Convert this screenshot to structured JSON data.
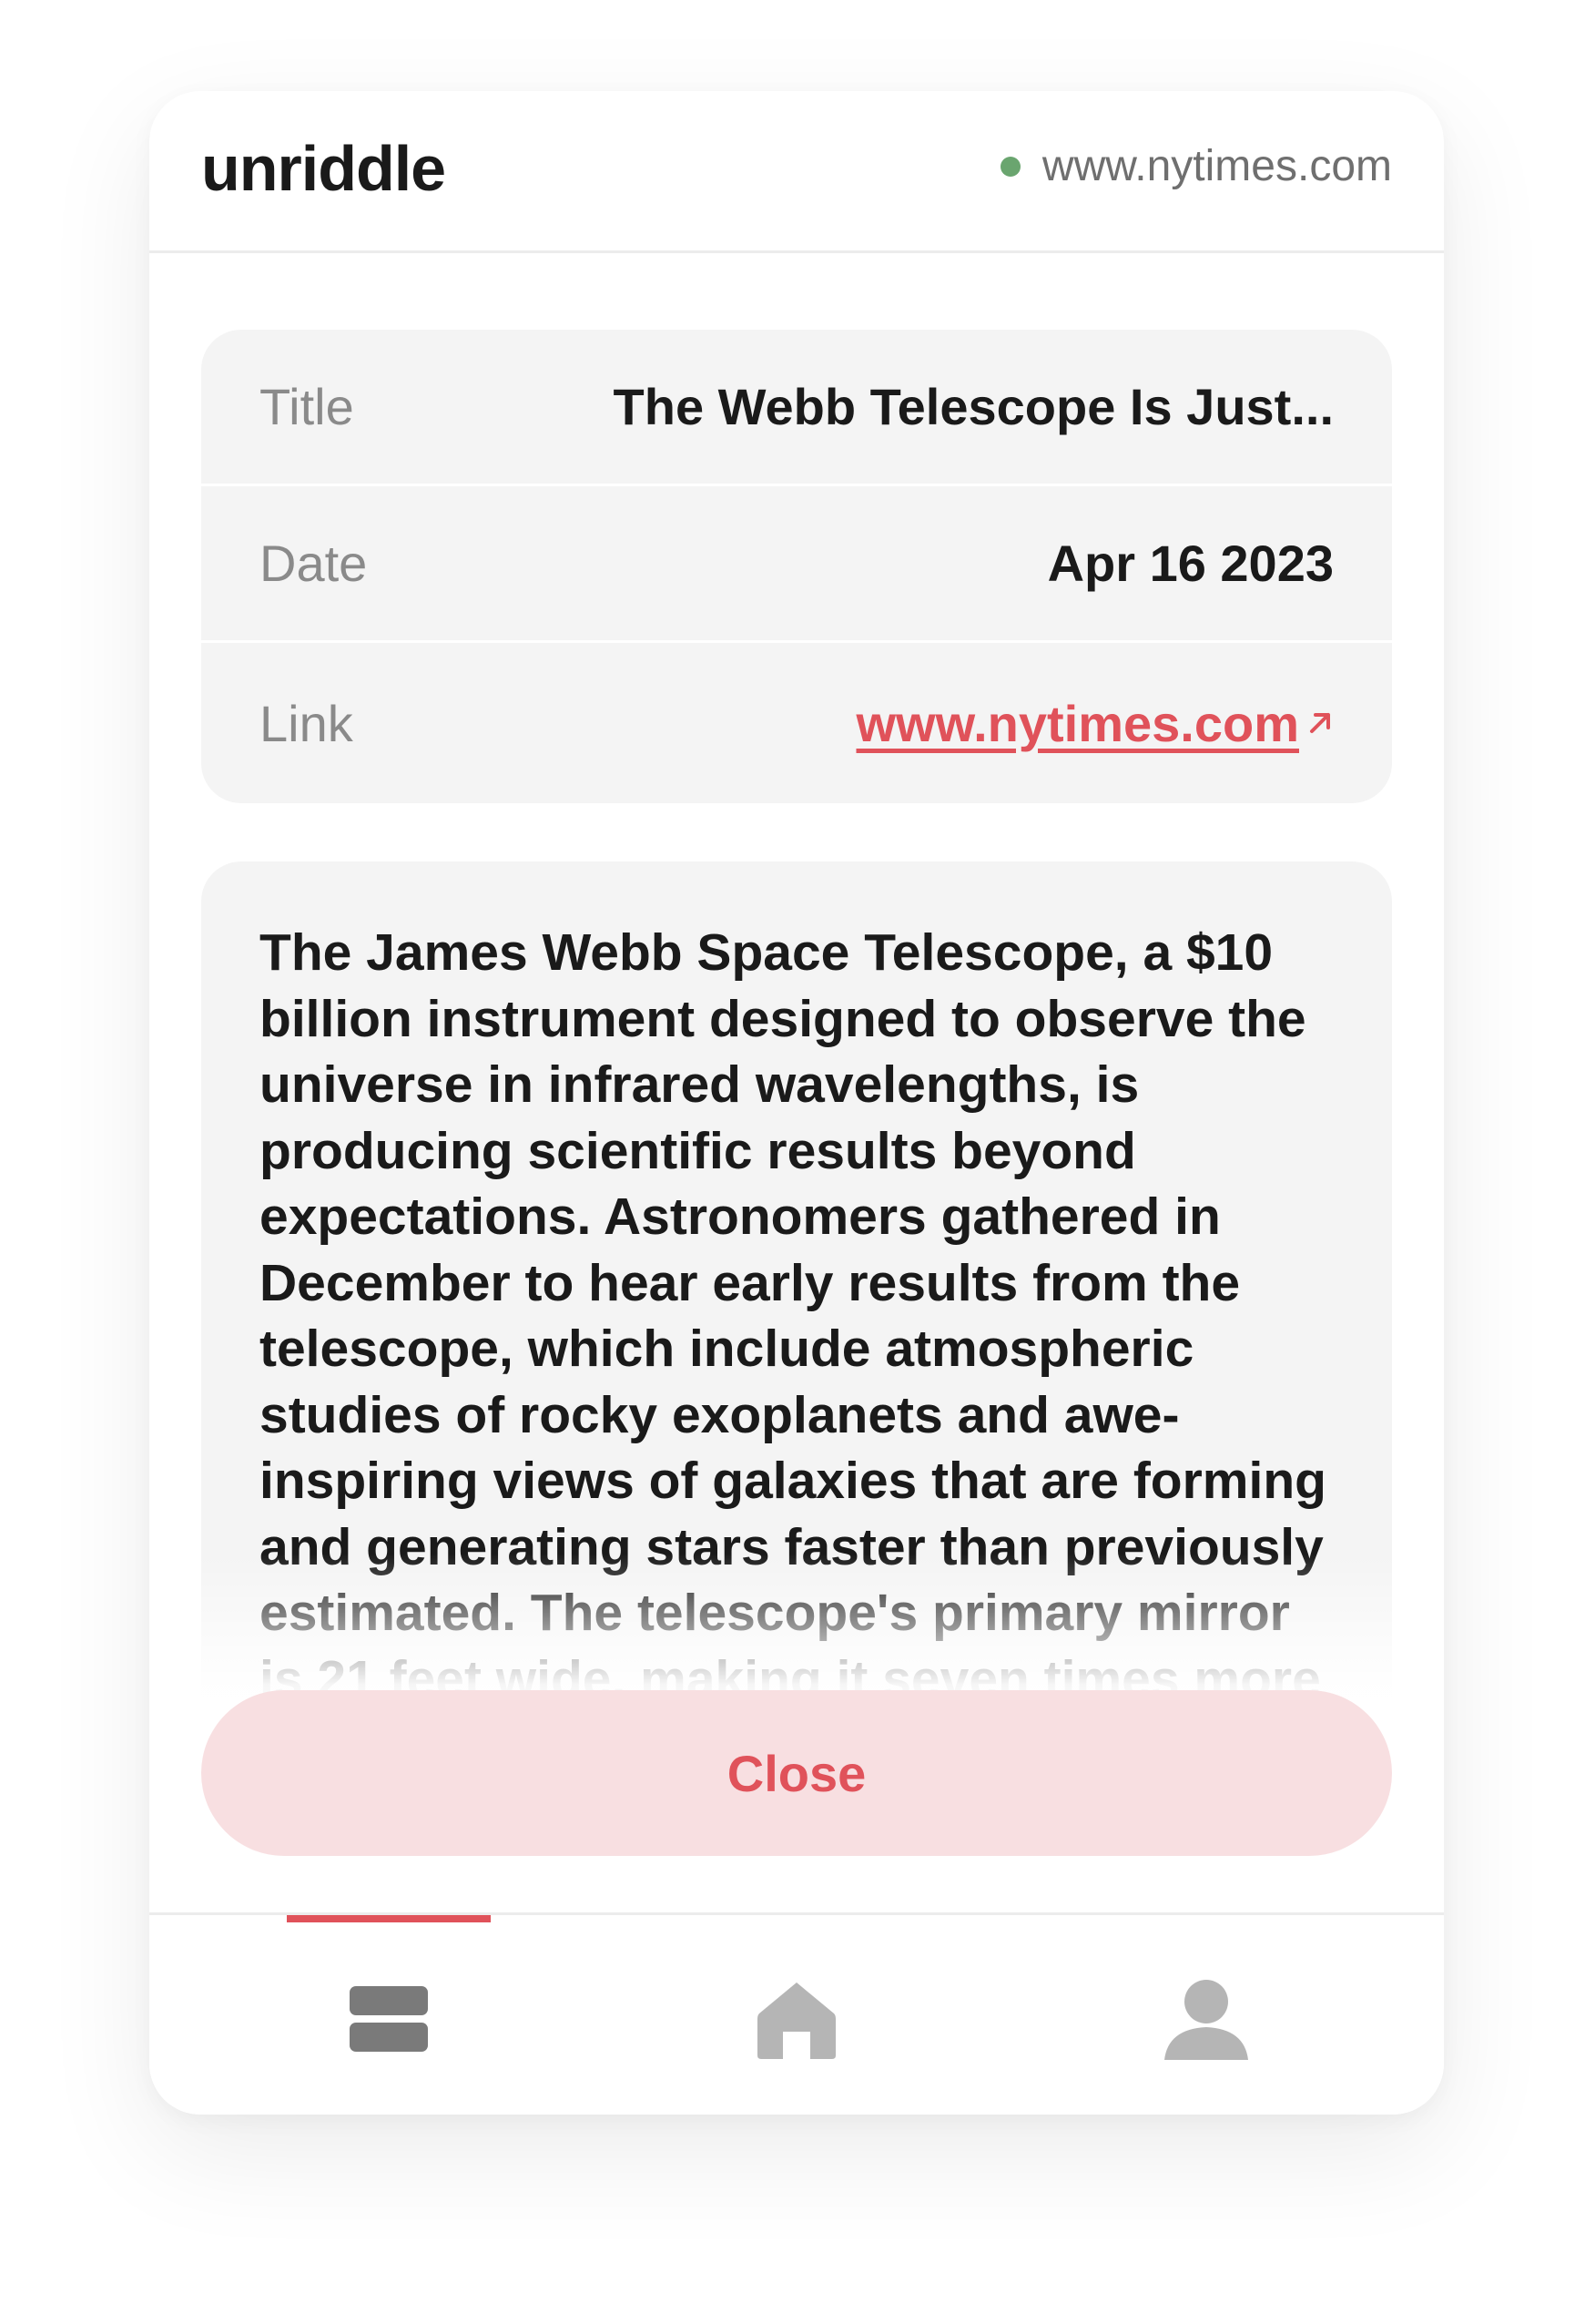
{
  "app": {
    "name": "unriddle"
  },
  "header": {
    "site": "www.nytimes.com",
    "status_color": "#6aa56f"
  },
  "meta": [
    {
      "label": "Title",
      "value": "The Webb Telescope Is Just..."
    },
    {
      "label": "Date",
      "value": "Apr 16 2023"
    },
    {
      "label": "Link",
      "value": "www.nytimes.com",
      "icon": "external-link-arrow-icon"
    }
  ],
  "summary": {
    "text": "The James Webb Space Telescope, a $10 billion instrument designed to observe the universe in infrared wavelengths, is producing scientific results beyond expectations. Astronomers gathered in December to hear early results from the telescope, which include atmospheric studies of rocky exoplanets and awe-inspiring views of galaxies that are forming and generating stars faster than previously estimated. The telescope's primary mirror is 21 feet wide, making it seven times more"
  },
  "actions": {
    "close_label": "Close"
  },
  "bottom_nav": {
    "items": [
      {
        "icon": "list-icon",
        "active": true
      },
      {
        "icon": "home-icon",
        "active": false
      },
      {
        "icon": "profile-icon",
        "active": false
      }
    ],
    "accent_color": "#e0525a"
  }
}
